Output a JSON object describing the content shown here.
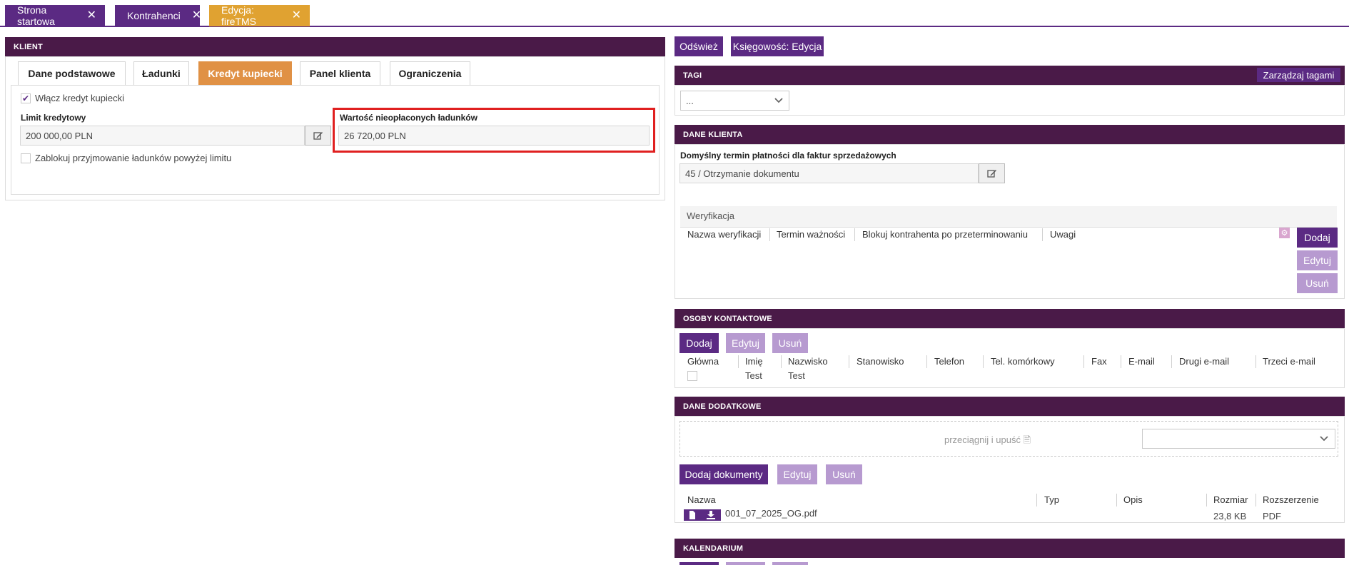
{
  "top_tabs": [
    {
      "label": "Strona startowa"
    },
    {
      "label": "Kontrahenci"
    },
    {
      "label": "Edycja: fireTMS"
    }
  ],
  "klient": {
    "title": "KLIENT",
    "tabs": [
      "Dane podstawowe",
      "Ładunki",
      "Kredyt kupiecki",
      "Panel klienta",
      "Ograniczenia"
    ],
    "active_tab": "Kredyt kupiecki",
    "enable_credit_label": "Włącz kredyt kupiecki",
    "enable_credit_checked": true,
    "limit_label": "Limit kredytowy",
    "limit_value": "200 000,00 PLN",
    "unpaid_label": "Wartość nieopłaconych ładunków",
    "unpaid_value": "26 720,00 PLN",
    "block_label": "Zablokuj przyjmowanie ładunków powyżej limitu",
    "block_checked": false
  },
  "actions": {
    "refresh": "Odśwież",
    "accounting": "Księgowość: Edycja"
  },
  "tagi": {
    "title": "TAGI",
    "manage": "Zarządzaj tagami",
    "select_value": "..."
  },
  "dane_klienta": {
    "title": "DANE KLIENTA",
    "payment_label": "Domyślny termin płatności dla faktur sprzedażowych",
    "payment_value": "45 / Otrzymanie dokumentu",
    "verification_title": "Weryfikacja",
    "columns": [
      "Nazwa weryfikacji",
      "Termin ważności",
      "Blokuj kontrahenta po przeterminowaniu",
      "Uwagi"
    ],
    "buttons": {
      "add": "Dodaj",
      "edit": "Edytuj",
      "delete": "Usuń"
    }
  },
  "osoby": {
    "title": "OSOBY KONTAKTOWE",
    "buttons": {
      "add": "Dodaj",
      "edit": "Edytuj",
      "delete": "Usuń"
    },
    "columns": [
      "Główna",
      "Imię",
      "Nazwisko",
      "Stanowisko",
      "Telefon",
      "Tel. komórkowy",
      "Fax",
      "E-mail",
      "Drugi e-mail",
      "Trzeci e-mail"
    ],
    "rows": [
      {
        "glowna": false,
        "imie": "Test",
        "nazwisko": "Test"
      }
    ]
  },
  "dane_dodatkowe": {
    "title": "DANE DODATKOWE",
    "dropzone": "przeciągnij i upuść",
    "buttons": {
      "add": "Dodaj dokumenty",
      "edit": "Edytuj",
      "delete": "Usuń"
    },
    "columns": [
      "Nazwa",
      "Typ",
      "Opis",
      "Rozmiar",
      "Rozszerzenie"
    ],
    "files": [
      {
        "name": "001_07_2025_OG.pdf",
        "type": "",
        "desc": "",
        "size": "23,8 KB",
        "ext": "PDF"
      }
    ]
  },
  "kalendarium": {
    "title": "KALENDARIUM"
  },
  "colors": {
    "purple": "#5b2a83",
    "header": "#4a1a48",
    "orange": "#e09145",
    "yellow": "#e0a231",
    "highlight": "#e02020"
  }
}
